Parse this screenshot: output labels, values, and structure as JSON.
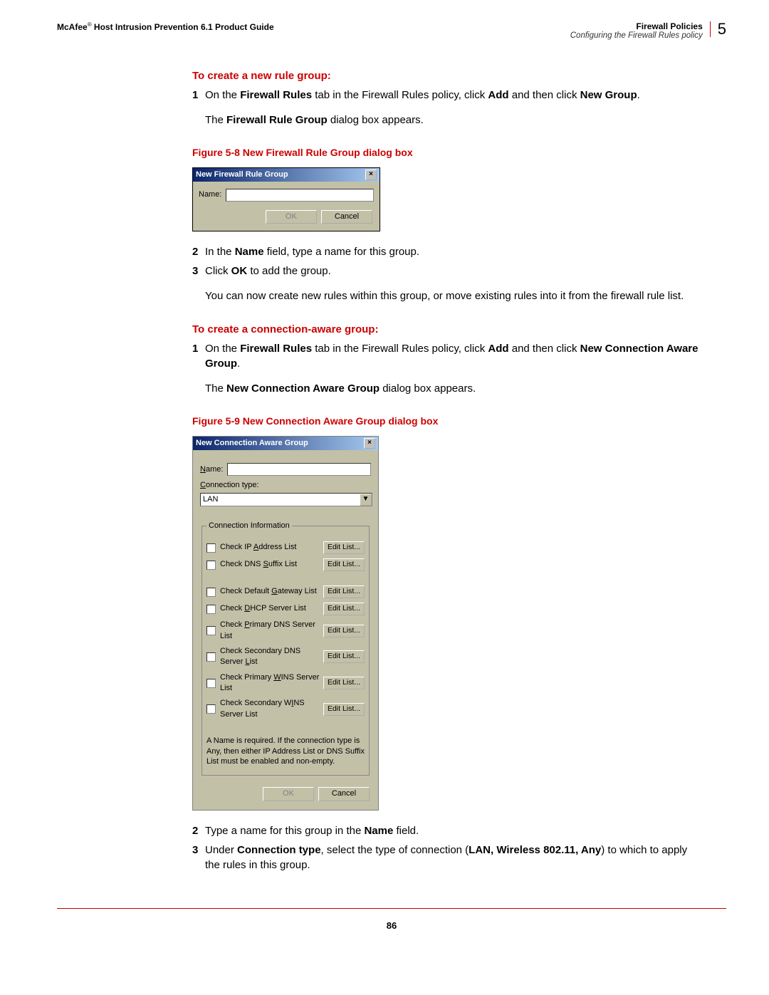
{
  "header": {
    "left_prefix": "McAfee",
    "left_suffix": " Host Intrusion Prevention 6.1 Product Guide",
    "right_title": "Firewall Policies",
    "right_sub": "Configuring the Firewall Rules policy",
    "chapter_number": "5"
  },
  "section1": {
    "head": "To create a new rule group:",
    "step1_pre": "On the ",
    "step1_bold1": "Firewall Rules",
    "step1_mid": " tab in the Firewall Rules policy, click ",
    "step1_bold2": "Add",
    "step1_mid2": " and then click ",
    "step1_bold3": "New Group",
    "step1_end": ".",
    "para1_pre": "The ",
    "para1_bold": "Firewall Rule Group",
    "para1_end": " dialog box appears.",
    "fig_caption": "Figure 5-8  New Firewall Rule Group dialog box"
  },
  "dlg58": {
    "title": "New Firewall Rule Group",
    "name_label": "Name:",
    "ok": "OK",
    "cancel": "Cancel"
  },
  "section1b": {
    "step2_pre": "In the ",
    "step2_bold": "Name",
    "step2_end": " field, type a name for this group.",
    "step3_pre": "Click ",
    "step3_bold": "OK",
    "step3_end": " to add the group.",
    "para2": "You can now create new rules within this group, or move existing rules into it from the firewall rule list."
  },
  "section2": {
    "head": "To create a connection-aware group:",
    "step1_pre": "On the ",
    "step1_bold1": "Firewall Rules",
    "step1_mid": " tab in the Firewall Rules policy, click ",
    "step1_bold2": "Add",
    "step1_mid2": " and then click ",
    "step1_bold3": "New Connection Aware Group",
    "step1_end": ".",
    "para1_pre": "The ",
    "para1_bold": "New Connection Aware Group",
    "para1_end": " dialog box appears.",
    "fig_caption": "Figure 5-9  New Connection Aware Group dialog box"
  },
  "dlg59": {
    "title": "New Connection Aware Group",
    "name_label": "Name:",
    "conn_type_label": "Connection type:",
    "conn_type_value": "LAN",
    "fieldset_legend": "Connection Information",
    "edit": "Edit List...",
    "checks": [
      {
        "pre": "Check IP ",
        "u": "A",
        "post": "ddress List"
      },
      {
        "pre": "Check DNS ",
        "u": "S",
        "post": "uffix List"
      },
      {
        "pre": "Check Default ",
        "u": "G",
        "post": "ateway List"
      },
      {
        "pre": "Check ",
        "u": "D",
        "post": "HCP Server List"
      },
      {
        "pre": "Check ",
        "u": "P",
        "post": "rimary DNS Server List"
      },
      {
        "pre": "Check Secondary DNS Server ",
        "u": "L",
        "post": "ist"
      },
      {
        "pre": "Check Primary ",
        "u": "W",
        "post": "INS Server List"
      },
      {
        "pre": "Check Secondary W",
        "u": "I",
        "post": "NS Server List"
      }
    ],
    "note": "A Name is required.  If the connection type is Any, then either IP Address List or DNS Suffix List must be enabled and non-empty.",
    "ok": "OK",
    "cancel": "Cancel"
  },
  "section2b": {
    "step2_pre": "Type a name for this group in the ",
    "step2_bold": "Name",
    "step2_end": " field.",
    "step3_pre": "Under ",
    "step3_bold1": "Connection type",
    "step3_mid": ", select the type of connection (",
    "step3_bold2": "LAN, Wireless 802.11, Any",
    "step3_end": ") to which to apply the rules in this group."
  },
  "page_number": "86"
}
